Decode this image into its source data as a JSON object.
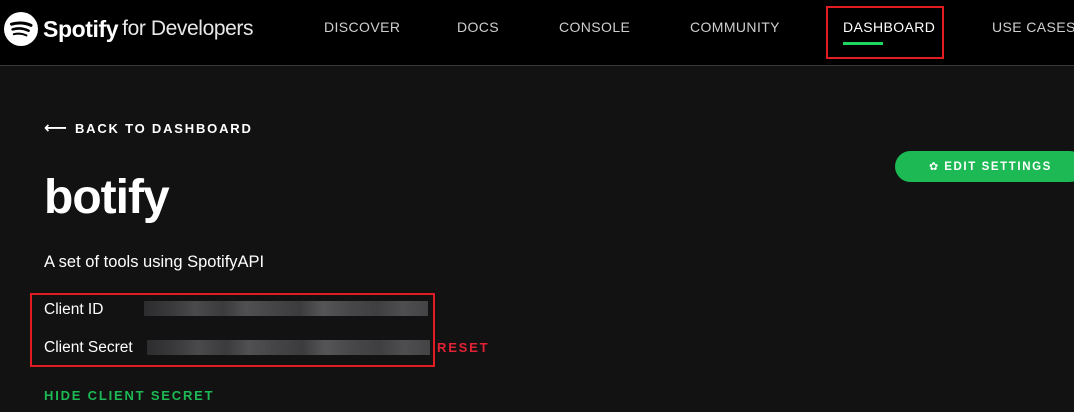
{
  "header": {
    "brand": "Spotify",
    "brand_sub": "for Developers",
    "nav": {
      "discover": "DISCOVER",
      "docs": "DOCS",
      "console": "CONSOLE",
      "community": "COMMUNITY",
      "dashboard": "DASHBOARD",
      "use_cases": "USE CASES"
    },
    "active_nav": "dashboard"
  },
  "page": {
    "back_label": "BACK TO DASHBOARD",
    "back_arrow": "⟵",
    "edit_settings_label": "EDIT SETTINGS",
    "app_name": "botify",
    "app_description": "A set of tools using SpotifyAPI",
    "client_id_label": "Client ID",
    "client_secret_label": "Client Secret",
    "reset_label": "RESET",
    "hide_secret_label": "HIDE CLIENT SECRET"
  },
  "colors": {
    "accent_green": "#1db954",
    "reset_red": "#e22134",
    "annotation_red": "#e31b23",
    "background": "#121212"
  },
  "icons": {
    "logo": "spotify-logo-icon",
    "back": "arrow-left-icon",
    "settings": "gear-icon"
  }
}
